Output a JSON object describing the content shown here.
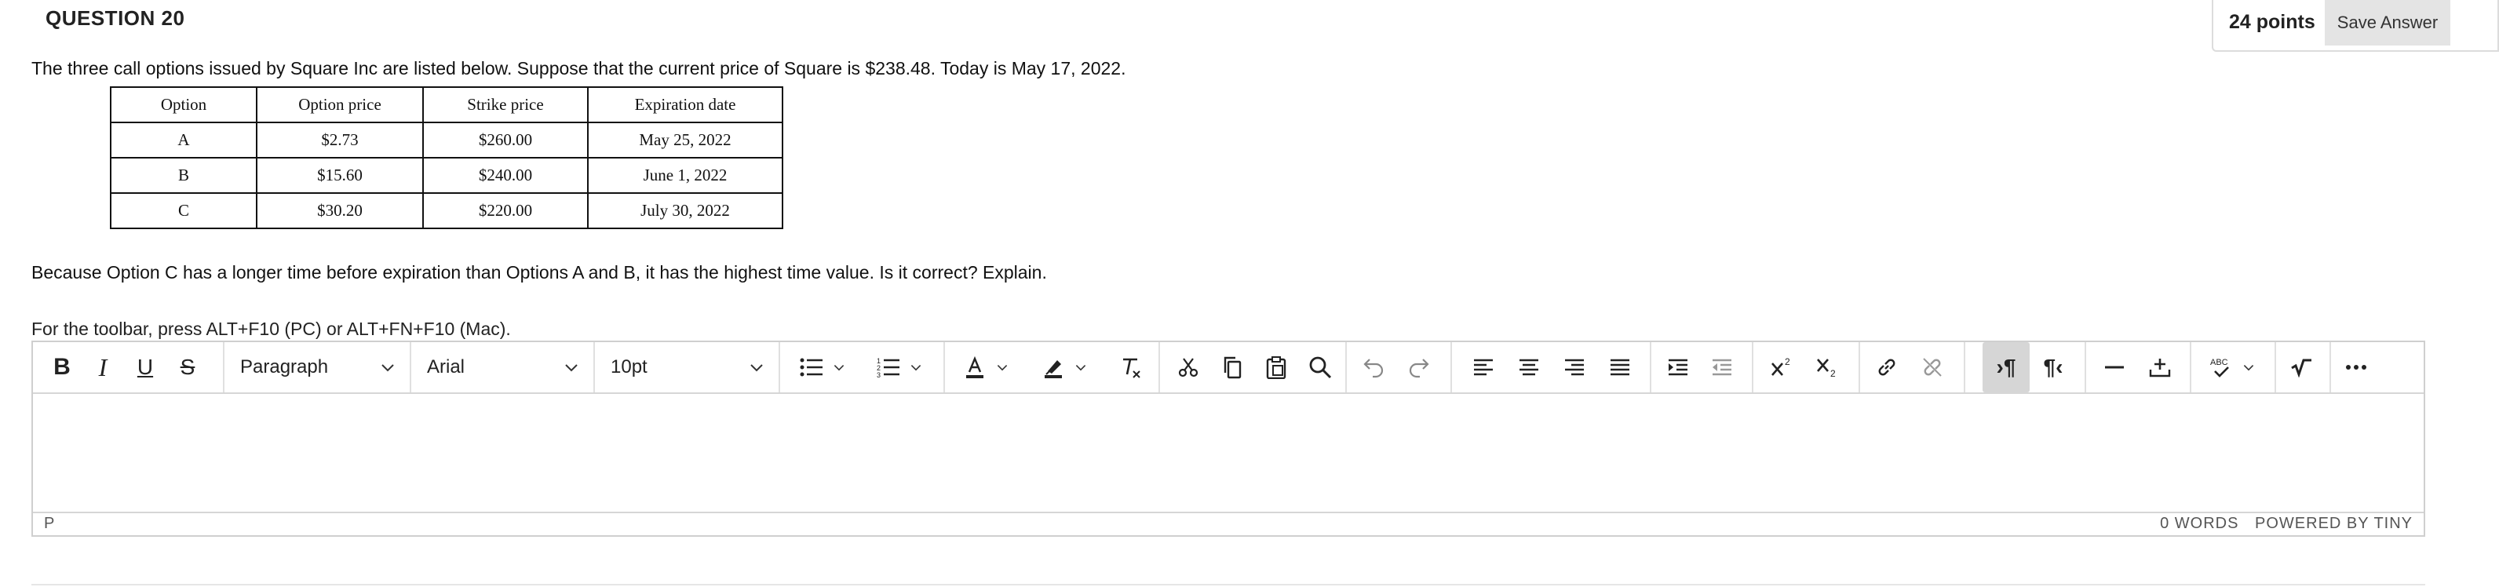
{
  "question": {
    "title": "QUESTION 20",
    "points": "24 points",
    "save_label": "Save Answer",
    "prompt": "The three call options issued by Square Inc are listed below. Suppose that the current price of Square is $238.48. Today is May 17, 2022.",
    "followup": "Because Option C has a longer time before expiration than Options A and B, it has the highest time value. Is it correct? Explain."
  },
  "table": {
    "headers": [
      "Option",
      "Option price",
      "Strike price",
      "Expiration date"
    ],
    "rows": [
      [
        "A",
        "$2.73",
        "$260.00",
        "May 25, 2022"
      ],
      [
        "B",
        "$15.60",
        "$240.00",
        "June 1, 2022"
      ],
      [
        "C",
        "$30.20",
        "$220.00",
        "July 30, 2022"
      ]
    ]
  },
  "editor": {
    "toolbar_hint": "For the toolbar, press ALT+F10 (PC) or ALT+FN+F10 (Mac).",
    "block_format": "Paragraph",
    "font_family": "Arial",
    "font_size": "10pt",
    "path": "P",
    "word_count": "0 WORDS",
    "powered_by": "POWERED BY TINY",
    "icons": [
      "bold-icon",
      "italic-icon",
      "underline-icon",
      "strikethrough-icon",
      "bullet-list-icon",
      "numbered-list-icon",
      "text-color-icon",
      "highlight-icon",
      "clear-format-icon",
      "cut-icon",
      "copy-icon",
      "paste-icon",
      "find-icon",
      "undo-icon",
      "redo-icon",
      "align-left-icon",
      "align-center-icon",
      "align-right-icon",
      "justify-icon",
      "indent-icon",
      "outdent-icon",
      "superscript-icon",
      "subscript-icon",
      "link-icon",
      "unlink-icon",
      "ltr-icon",
      "rtl-icon",
      "horizontal-rule-icon",
      "insert-icon",
      "spellcheck-icon",
      "math-icon",
      "more-icon"
    ],
    "text_color": "#222222",
    "accent_color": "#d6d6d6"
  }
}
